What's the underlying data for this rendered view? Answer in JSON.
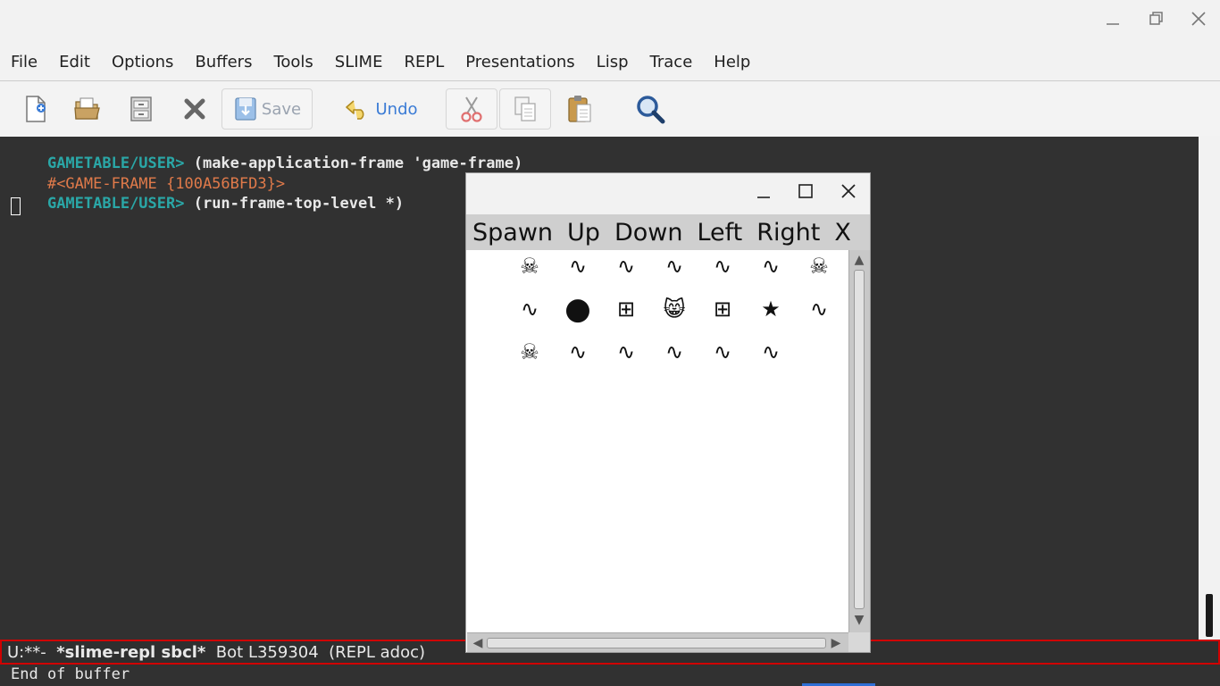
{
  "titlebar": {
    "minimize_icon": "minimize-icon",
    "maximize_icon": "maximize-icon",
    "close_icon": "close-icon"
  },
  "menu": {
    "items": [
      "File",
      "Edit",
      "Options",
      "Buffers",
      "Tools",
      "SLIME",
      "REPL",
      "Presentations",
      "Lisp",
      "Trace",
      "Help"
    ]
  },
  "toolbar": {
    "save_label": "Save",
    "undo_label": "Undo"
  },
  "repl": {
    "line1_prompt": "GAMETABLE/USER>",
    "line1_cmd": " (make-application-frame 'game-frame)",
    "line2_result": "#<GAME-FRAME {100A56BFD3}>",
    "line3_prompt": "GAMETABLE/USER>",
    "line3_cmd": " (run-frame-top-level *)"
  },
  "modeline": {
    "status": "U:**-  ",
    "buffer_name": "*slime-repl sbcl*",
    "position": "  Bot L359304  (REPL adoc)"
  },
  "echo_area": {
    "message": "End of buffer"
  },
  "game_window": {
    "menu": [
      "Spawn",
      "Up",
      "Down",
      "Left",
      "Right",
      "X"
    ],
    "rows": [
      [
        "☠",
        "∿",
        "∿",
        "∿",
        "∿",
        "∿",
        "☠"
      ],
      [
        "∿",
        "●",
        "⊞",
        "😸",
        "⊞",
        "★",
        "∿"
      ],
      [
        "☠",
        "∿",
        "∿",
        "∿",
        "∿",
        "∿",
        ""
      ]
    ]
  },
  "colors": {
    "prompt": "#2aa7a7",
    "result": "#e07a4a",
    "repl_bg": "#313131",
    "modeline_border": "#d00000"
  }
}
